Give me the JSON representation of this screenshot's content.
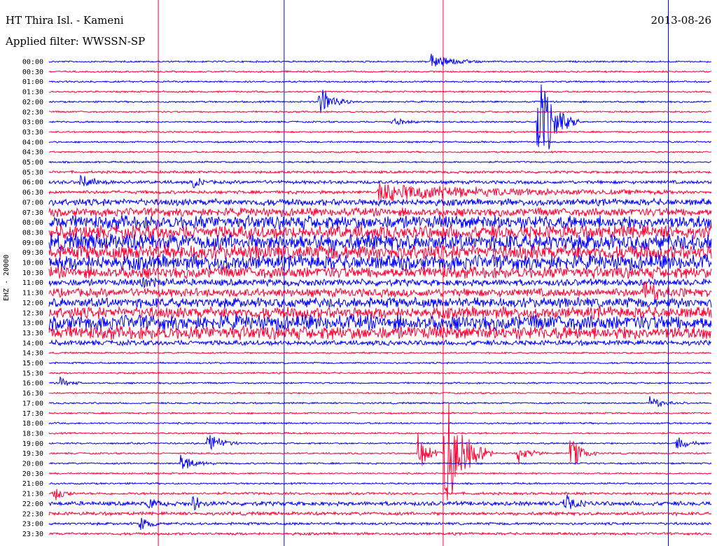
{
  "header": {
    "station": "HT Thira Isl. - Kameni",
    "filter": "Applied filter: WWSSN-SP",
    "date": "2013-08-26"
  },
  "chart_data": {
    "type": "line",
    "title": "HT Thira Isl. - Kameni",
    "subtitle": "Applied filter: WWSSN-SP",
    "date": "2013-08-26",
    "ylabel": "EHZ - 20000",
    "row_labels": [
      "00:00",
      "00:30",
      "01:00",
      "01:30",
      "02:00",
      "02:30",
      "03:00",
      "03:30",
      "04:00",
      "04:30",
      "05:00",
      "05:30",
      "06:00",
      "06:30",
      "07:00",
      "07:30",
      "08:00",
      "08:30",
      "09:00",
      "09:30",
      "10:00",
      "10:30",
      "11:00",
      "11:30",
      "12:00",
      "12:30",
      "13:00",
      "13:30",
      "14:00",
      "14:30",
      "15:00",
      "15:30",
      "16:00",
      "16:30",
      "17:00",
      "17:30",
      "18:00",
      "18:30",
      "19:00",
      "19:30",
      "20:00",
      "20:30",
      "21:00",
      "21:30",
      "22:00",
      "22:30",
      "23:00",
      "23:30"
    ],
    "row_colors": [
      "#0000ff",
      "#ff0033"
    ],
    "colors": {
      "blue": "#0000ff",
      "red": "#ff0033",
      "marker": "#ff0033"
    },
    "noise_levels": [
      1,
      1,
      1,
      1,
      1,
      1,
      1,
      1,
      1,
      1,
      1,
      1.5,
      2,
      2,
      4,
      5,
      8,
      8,
      10,
      9,
      9,
      7,
      4,
      5,
      6,
      7,
      9,
      8,
      3,
      1,
      1,
      1,
      1,
      1,
      1,
      1,
      1,
      1,
      1,
      1,
      1,
      1,
      1,
      1.5,
      2.5,
      2,
      1.5,
      1.5
    ],
    "events": [
      {
        "row": 0,
        "x": 0.58,
        "amp": 12,
        "dur": 0.08
      },
      {
        "row": 4,
        "x": 0.41,
        "amp": 25,
        "dur": 0.05
      },
      {
        "row": 6,
        "x": 0.74,
        "amp": 80,
        "dur": 0.06
      },
      {
        "row": 6,
        "x": 0.52,
        "amp": 6,
        "dur": 0.05
      },
      {
        "row": 12,
        "x": 0.05,
        "amp": 10,
        "dur": 0.05
      },
      {
        "row": 12,
        "x": 0.22,
        "amp": 10,
        "dur": 0.02
      },
      {
        "row": 13,
        "x": 0.5,
        "amp": 14,
        "dur": 0.45
      },
      {
        "row": 22,
        "x": 0.14,
        "amp": 8,
        "dur": 0.05
      },
      {
        "row": 23,
        "x": 0.9,
        "amp": 15,
        "dur": 0.06
      },
      {
        "row": 32,
        "x": 0.02,
        "amp": 8,
        "dur": 0.03
      },
      {
        "row": 34,
        "x": 0.91,
        "amp": 10,
        "dur": 0.05
      },
      {
        "row": 38,
        "x": 0.24,
        "amp": 20,
        "dur": 0.05
      },
      {
        "row": 38,
        "x": 0.95,
        "amp": 10,
        "dur": 0.04
      },
      {
        "row": 39,
        "x": 0.56,
        "amp": 30,
        "dur": 0.04
      },
      {
        "row": 39,
        "x": 0.6,
        "amp": 90,
        "dur": 0.07
      },
      {
        "row": 39,
        "x": 0.71,
        "amp": 15,
        "dur": 0.04
      },
      {
        "row": 39,
        "x": 0.79,
        "amp": 25,
        "dur": 0.04
      },
      {
        "row": 40,
        "x": 0.2,
        "amp": 15,
        "dur": 0.05
      },
      {
        "row": 43,
        "x": 0.01,
        "amp": 12,
        "dur": 0.03
      },
      {
        "row": 44,
        "x": 0.15,
        "amp": 10,
        "dur": 0.03
      },
      {
        "row": 44,
        "x": 0.22,
        "amp": 14,
        "dur": 0.03
      },
      {
        "row": 44,
        "x": 0.78,
        "amp": 12,
        "dur": 0.04
      },
      {
        "row": 46,
        "x": 0.14,
        "amp": 14,
        "dur": 0.03
      }
    ],
    "markers": [
      0.165,
      0.355,
      0.595,
      0.935
    ]
  }
}
